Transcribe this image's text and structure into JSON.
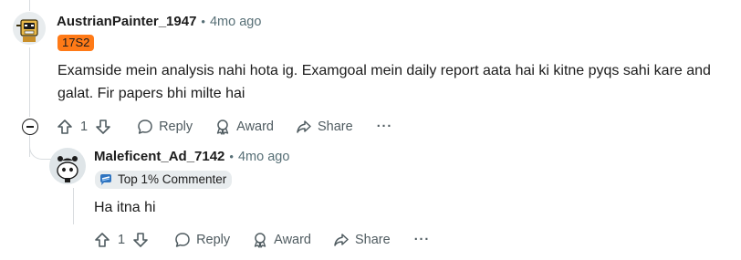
{
  "comments": [
    {
      "username": "AustrianPainter_1947",
      "separator": "•",
      "time": "4mo ago",
      "flair": "17S2",
      "flair_color": "#ff7a17",
      "body": "Examside mein analysis nahi hota ig. Examgoal mein daily report aata hai ki kitne pyqs sahi kare and galat. Fir papers bhi milte hai",
      "votes": "1",
      "actions": {
        "reply": "Reply",
        "award": "Award",
        "share": "Share",
        "more": "···"
      }
    },
    {
      "username": "Maleficent_Ad_7142",
      "separator": "•",
      "time": "4mo ago",
      "flair": "Top 1% Commenter",
      "flair_icon": "top-commenter-icon",
      "body": "Ha itna hi",
      "votes": "1",
      "actions": {
        "reply": "Reply",
        "award": "Award",
        "share": "Share",
        "more": "···"
      }
    }
  ],
  "icons": {
    "upvote": "upvote-arrow-icon",
    "downvote": "downvote-arrow-icon",
    "reply": "speech-bubble-icon",
    "award": "award-icon",
    "share": "share-arrow-icon",
    "collapse": "collapse-minus-icon"
  }
}
